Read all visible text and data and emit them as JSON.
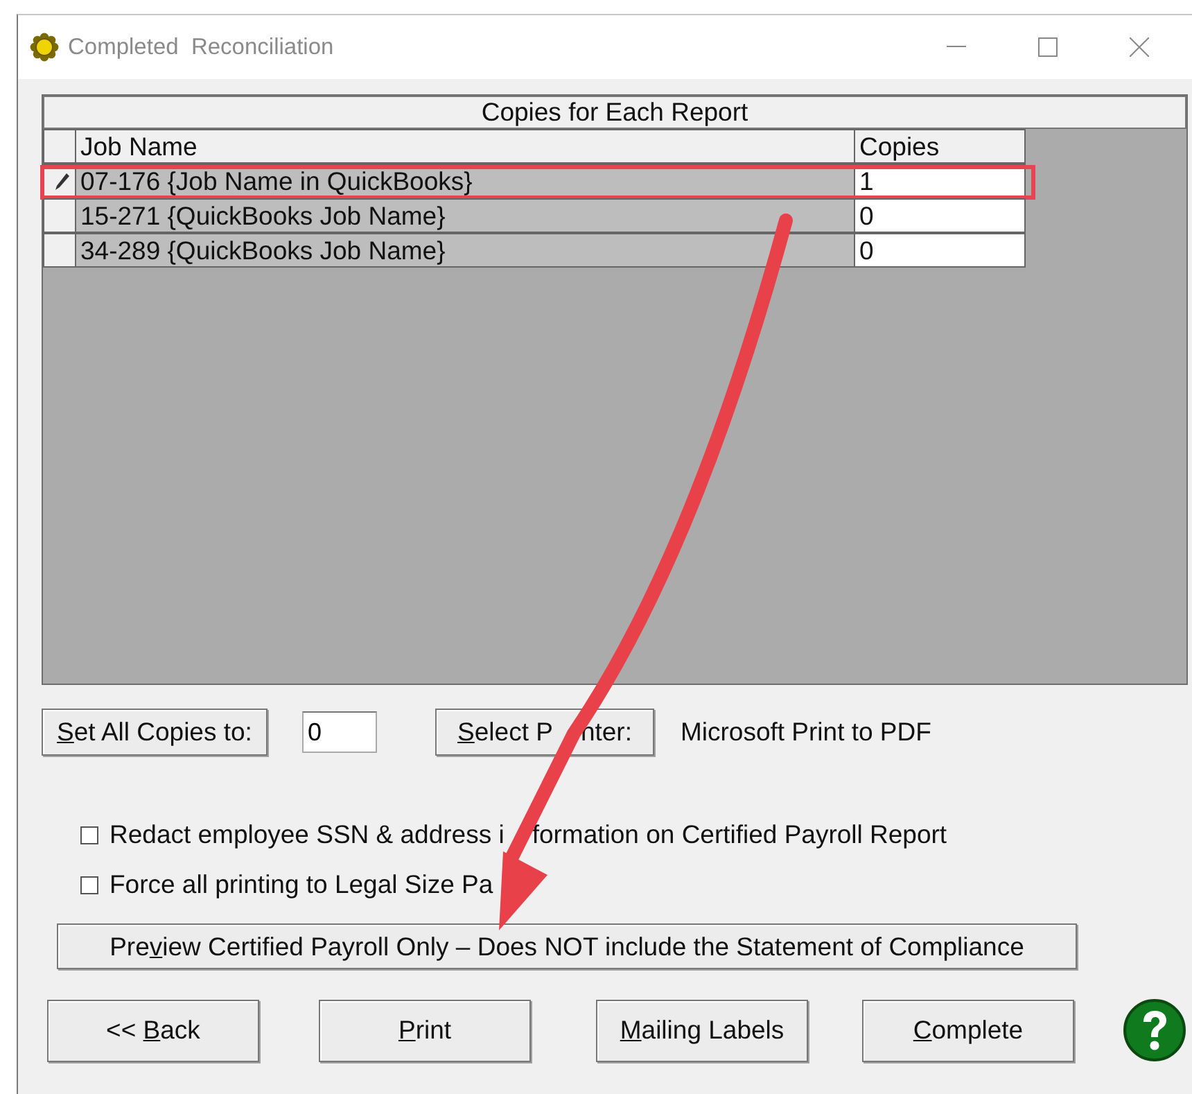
{
  "window": {
    "title": "Completed  Reconciliation"
  },
  "grid": {
    "title": "Copies for Each Report",
    "columns": [
      "Job Name",
      "Copies"
    ],
    "rows": [
      {
        "job_name": "07-176 {Job Name in QuickBooks}",
        "copies": "1",
        "editing": true,
        "highlighted": true
      },
      {
        "job_name": "15-271 {QuickBooks Job Name}",
        "copies": "0",
        "editing": false,
        "highlighted": false
      },
      {
        "job_name": "34-289 {QuickBooks Job Name}",
        "copies": "0",
        "editing": false,
        "highlighted": false
      }
    ]
  },
  "set_all_button": {
    "label": [
      {
        "text": "S",
        "underlined": true
      },
      {
        "text": "et All Copies to:",
        "underlined": false
      }
    ]
  },
  "set_all_value": "0",
  "select_printer_button": {
    "label": [
      {
        "text": "S",
        "underlined": true
      },
      {
        "text": "elect P",
        "underlined": false
      }
    ],
    "label_after_arrow": "nter:"
  },
  "printer_name": "Microsoft Print to PDF",
  "options": [
    {
      "label": "Redact employee SSN & address i",
      "label_after_arrow": "formation on Certified Payroll Report",
      "checked": false
    },
    {
      "label": "Force all printing to Legal Size Pa",
      "checked": false
    }
  ],
  "preview_button": {
    "label": [
      {
        "text": "Pre",
        "underlined": false
      },
      {
        "text": "v",
        "underlined": true
      },
      {
        "text": "iew Certified Payroll Only – Does NOT include the Statement of Compliance",
        "underlined": false
      }
    ]
  },
  "buttons": [
    {
      "label": [
        {
          "text": "<< ",
          "underlined": false
        },
        {
          "text": "B",
          "underlined": true
        },
        {
          "text": "ack",
          "underlined": false
        }
      ]
    },
    {
      "label": [
        {
          "text": "P",
          "underlined": true
        },
        {
          "text": "rint",
          "underlined": false
        }
      ]
    },
    {
      "label": [
        {
          "text": "M",
          "underlined": true
        },
        {
          "text": "ailing Labels",
          "underlined": false
        }
      ]
    },
    {
      "label": [
        {
          "text": "C",
          "underlined": true
        },
        {
          "text": "omplete",
          "underlined": false
        }
      ]
    }
  ],
  "annotations": [
    {
      "kind": "arrow"
    }
  ]
}
